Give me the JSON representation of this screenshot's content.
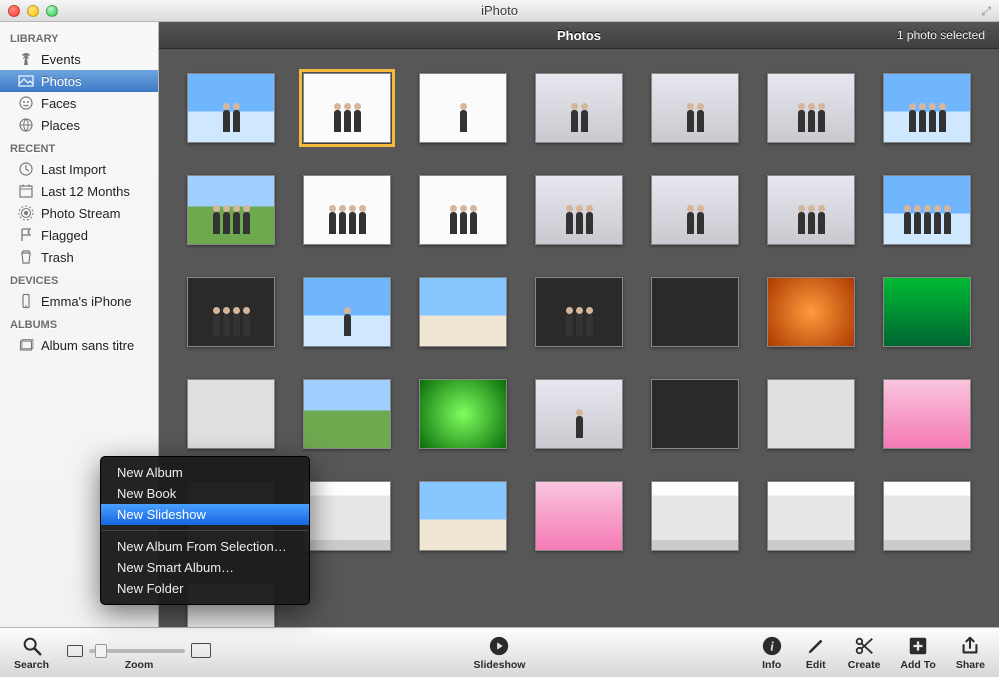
{
  "window": {
    "title": "iPhoto"
  },
  "sidebar": {
    "sections": [
      {
        "heading": "LIBRARY",
        "items": [
          {
            "label": "Events",
            "icon": "palm-icon"
          },
          {
            "label": "Photos",
            "icon": "photos-icon",
            "selected": true
          },
          {
            "label": "Faces",
            "icon": "faces-icon"
          },
          {
            "label": "Places",
            "icon": "globe-icon"
          }
        ]
      },
      {
        "heading": "RECENT",
        "items": [
          {
            "label": "Last Import",
            "icon": "clock-icon"
          },
          {
            "label": "Last 12 Months",
            "icon": "calendar-icon"
          },
          {
            "label": "Photo Stream",
            "icon": "stream-icon"
          },
          {
            "label": "Flagged",
            "icon": "flag-icon"
          },
          {
            "label": "Trash",
            "icon": "trash-icon"
          }
        ]
      },
      {
        "heading": "DEVICES",
        "items": [
          {
            "label": "Emma's iPhone",
            "icon": "phone-icon"
          }
        ]
      },
      {
        "heading": "ALBUMS",
        "items": [
          {
            "label": "Album sans titre",
            "icon": "album-icon"
          }
        ]
      }
    ]
  },
  "content": {
    "title": "Photos",
    "status": "1 photo selected"
  },
  "context_menu": {
    "items": [
      "New Album",
      "New Book",
      "New Slideshow",
      "-",
      "New Album From Selection…",
      "New Smart Album…",
      "New Folder"
    ],
    "highlighted": "New Slideshow"
  },
  "toolbar": {
    "search": "Search",
    "zoom": "Zoom",
    "slideshow": "Slideshow",
    "info": "Info",
    "edit": "Edit",
    "create": "Create",
    "addto": "Add To",
    "share": "Share"
  }
}
